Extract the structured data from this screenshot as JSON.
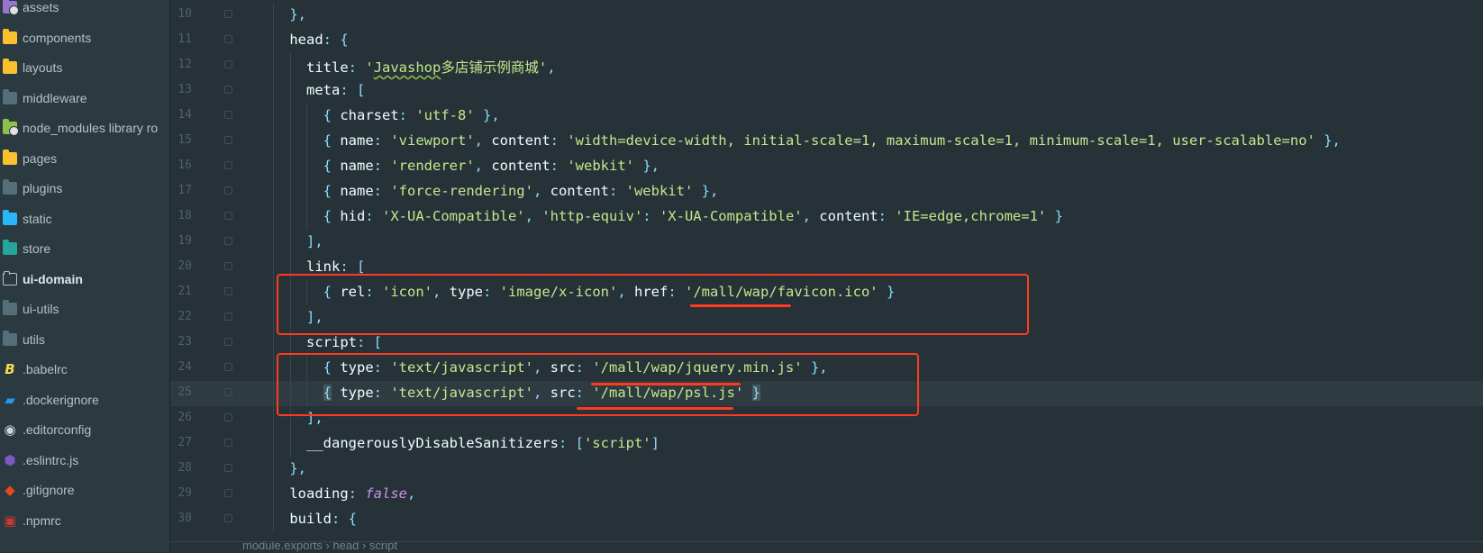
{
  "sidebar": {
    "items": [
      {
        "label": "assets",
        "icon": "folder-purple-icon"
      },
      {
        "label": "components",
        "icon": "folder-yellow-icon"
      },
      {
        "label": "layouts",
        "icon": "folder-yellow-icon"
      },
      {
        "label": "middleware",
        "icon": "folder-icon"
      },
      {
        "label": "node_modules  library ro",
        "icon": "folder-green-icon"
      },
      {
        "label": "pages",
        "icon": "folder-yellow-icon"
      },
      {
        "label": "plugins",
        "icon": "folder-icon"
      },
      {
        "label": "static",
        "icon": "folder-blue-icon"
      },
      {
        "label": "store",
        "icon": "folder-teal-icon"
      },
      {
        "label": "ui-domain",
        "icon": "folder-outline-icon"
      },
      {
        "label": "ui-utils",
        "icon": "folder-icon"
      },
      {
        "label": "utils",
        "icon": "folder-icon"
      },
      {
        "label": ".babelrc",
        "icon": "babel-icon"
      },
      {
        "label": ".dockerignore",
        "icon": "docker-icon"
      },
      {
        "label": ".editorconfig",
        "icon": "editorconfig-icon"
      },
      {
        "label": ".eslintrc.js",
        "icon": "eslint-icon"
      },
      {
        "label": ".gitignore",
        "icon": "git-icon"
      },
      {
        "label": ".npmrc",
        "icon": "npm-icon"
      }
    ]
  },
  "editor": {
    "lines": [
      {
        "n": "10",
        "t": [
          [
            "    ",
            "w"
          ],
          [
            "},",
            "p"
          ]
        ]
      },
      {
        "n": "11",
        "t": [
          [
            "    ",
            "w"
          ],
          [
            "head",
            "k"
          ],
          [
            ": {",
            "p"
          ]
        ]
      },
      {
        "n": "12",
        "t": [
          [
            "      ",
            "w"
          ],
          [
            "title",
            "k"
          ],
          [
            ": ",
            "p"
          ],
          [
            "'",
            "s"
          ],
          [
            "Javashop",
            "sq"
          ],
          [
            "多店铺示例商城",
            "s"
          ],
          [
            "'",
            "s"
          ],
          [
            ",",
            "p"
          ]
        ]
      },
      {
        "n": "13",
        "t": [
          [
            "      ",
            "w"
          ],
          [
            "meta",
            "k"
          ],
          [
            ": [",
            "p"
          ]
        ]
      },
      {
        "n": "14",
        "t": [
          [
            "        ",
            "w"
          ],
          [
            "{ ",
            "p"
          ],
          [
            "charset",
            "k"
          ],
          [
            ": ",
            "p"
          ],
          [
            "'utf-8'",
            "s"
          ],
          [
            " },",
            "p"
          ]
        ]
      },
      {
        "n": "15",
        "t": [
          [
            "        ",
            "w"
          ],
          [
            "{ ",
            "p"
          ],
          [
            "name",
            "k"
          ],
          [
            ": ",
            "p"
          ],
          [
            "'viewport'",
            "s"
          ],
          [
            ", ",
            "p"
          ],
          [
            "content",
            "k"
          ],
          [
            ": ",
            "p"
          ],
          [
            "'width=device-width, initial-scale=1, maximum-scale=1, minimum-scale=1, user-scalable=no'",
            "s"
          ],
          [
            " },",
            "p"
          ]
        ]
      },
      {
        "n": "16",
        "t": [
          [
            "        ",
            "w"
          ],
          [
            "{ ",
            "p"
          ],
          [
            "name",
            "k"
          ],
          [
            ": ",
            "p"
          ],
          [
            "'renderer'",
            "s"
          ],
          [
            ", ",
            "p"
          ],
          [
            "content",
            "k"
          ],
          [
            ": ",
            "p"
          ],
          [
            "'webkit'",
            "s"
          ],
          [
            " },",
            "p"
          ]
        ]
      },
      {
        "n": "17",
        "t": [
          [
            "        ",
            "w"
          ],
          [
            "{ ",
            "p"
          ],
          [
            "name",
            "k"
          ],
          [
            ": ",
            "p"
          ],
          [
            "'force-rendering'",
            "s"
          ],
          [
            ", ",
            "p"
          ],
          [
            "content",
            "k"
          ],
          [
            ": ",
            "p"
          ],
          [
            "'webkit'",
            "s"
          ],
          [
            " },",
            "p"
          ]
        ]
      },
      {
        "n": "18",
        "t": [
          [
            "        ",
            "w"
          ],
          [
            "{ ",
            "p"
          ],
          [
            "hid",
            "k"
          ],
          [
            ": ",
            "p"
          ],
          [
            "'X-UA-Compatible'",
            "s"
          ],
          [
            ", ",
            "p"
          ],
          [
            "'http-equiv'",
            "s"
          ],
          [
            ": ",
            "p"
          ],
          [
            "'X-UA-Compatible'",
            "s"
          ],
          [
            ", ",
            "p"
          ],
          [
            "content",
            "k"
          ],
          [
            ": ",
            "p"
          ],
          [
            "'IE=edge,chrome=1'",
            "s"
          ],
          [
            " }",
            "p"
          ]
        ]
      },
      {
        "n": "19",
        "t": [
          [
            "      ",
            "w"
          ],
          [
            "],",
            "p"
          ]
        ]
      },
      {
        "n": "20",
        "t": [
          [
            "      ",
            "w"
          ],
          [
            "link",
            "k"
          ],
          [
            ": [",
            "p"
          ]
        ]
      },
      {
        "n": "21",
        "t": [
          [
            "        ",
            "w"
          ],
          [
            "{ ",
            "p"
          ],
          [
            "rel",
            "k"
          ],
          [
            ": ",
            "p"
          ],
          [
            "'icon'",
            "s"
          ],
          [
            ", ",
            "p"
          ],
          [
            "type",
            "k"
          ],
          [
            ": ",
            "p"
          ],
          [
            "'image/x-icon'",
            "s"
          ],
          [
            ", ",
            "p"
          ],
          [
            "href",
            "k"
          ],
          [
            ": ",
            "p"
          ],
          [
            "'/mall/wap/favicon.ico'",
            "s"
          ],
          [
            " }",
            "p"
          ]
        ]
      },
      {
        "n": "22",
        "t": [
          [
            "      ",
            "w"
          ],
          [
            "],",
            "p"
          ]
        ]
      },
      {
        "n": "23",
        "t": [
          [
            "      ",
            "w"
          ],
          [
            "script",
            "k"
          ],
          [
            ": [",
            "p"
          ]
        ]
      },
      {
        "n": "24",
        "t": [
          [
            "        ",
            "w"
          ],
          [
            "{ ",
            "p"
          ],
          [
            "type",
            "k"
          ],
          [
            ": ",
            "p"
          ],
          [
            "'text/javascript'",
            "s"
          ],
          [
            ", ",
            "p"
          ],
          [
            "src",
            "k"
          ],
          [
            ": ",
            "p"
          ],
          [
            "'/mall/wap/jquery.min.js'",
            "s"
          ],
          [
            " },",
            "p"
          ]
        ]
      },
      {
        "n": "25",
        "t": [
          [
            "        ",
            "w"
          ],
          [
            "{",
            "hl"
          ],
          [
            " ",
            "w"
          ],
          [
            "type",
            "k"
          ],
          [
            ": ",
            "p"
          ],
          [
            "'text/javascript'",
            "s"
          ],
          [
            ", ",
            "p"
          ],
          [
            "src",
            "k"
          ],
          [
            ": ",
            "p"
          ],
          [
            "'/mall/wap/psl.js'",
            "s"
          ],
          [
            " ",
            "w"
          ],
          [
            "}",
            "hl"
          ]
        ]
      },
      {
        "n": "26",
        "t": [
          [
            "      ",
            "w"
          ],
          [
            "],",
            "p"
          ]
        ]
      },
      {
        "n": "27",
        "t": [
          [
            "      ",
            "w"
          ],
          [
            "__dangerouslyDisableSanitizers",
            "k"
          ],
          [
            ": [",
            "p"
          ],
          [
            "'script'",
            "s"
          ],
          [
            "]",
            "p"
          ]
        ]
      },
      {
        "n": "28",
        "t": [
          [
            "    ",
            "w"
          ],
          [
            "},",
            "p"
          ]
        ]
      },
      {
        "n": "29",
        "t": [
          [
            "    ",
            "w"
          ],
          [
            "loading",
            "k"
          ],
          [
            ": ",
            "p"
          ],
          [
            "false",
            "i"
          ],
          [
            ",",
            "p"
          ]
        ]
      },
      {
        "n": "30",
        "t": [
          [
            "    ",
            "w"
          ],
          [
            "build",
            "k"
          ],
          [
            ": {",
            "p"
          ]
        ]
      }
    ],
    "current_line": "25"
  },
  "breadcrumb": {
    "text": "module.exports  ›  head  ›  script"
  }
}
